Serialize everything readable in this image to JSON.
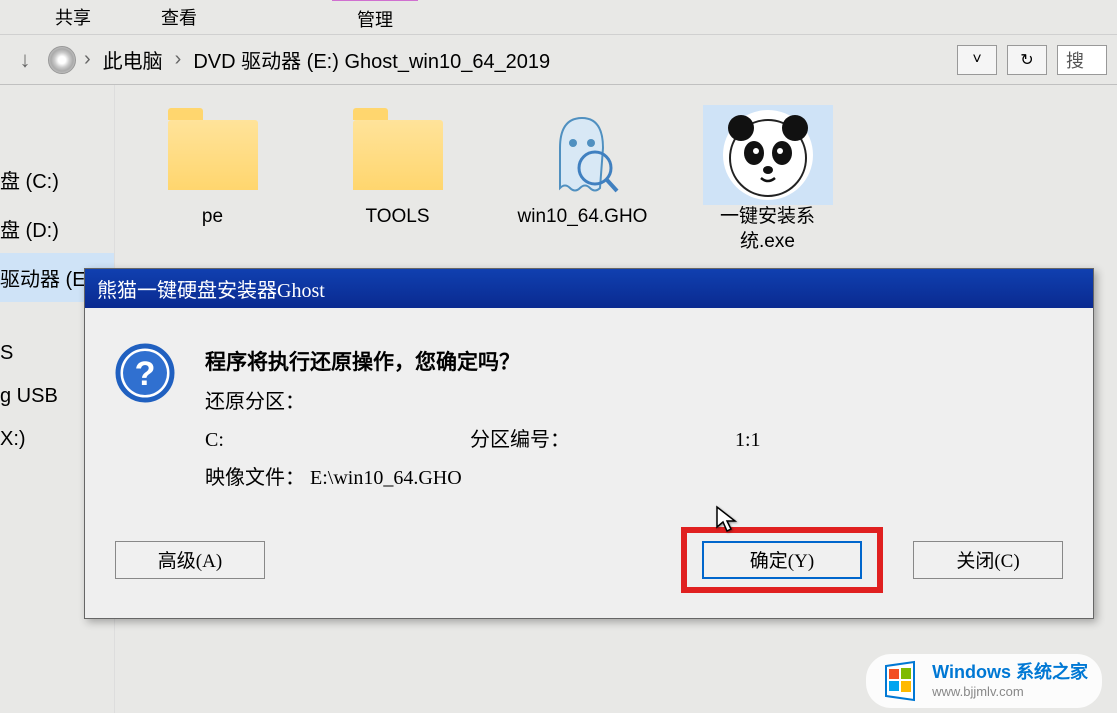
{
  "ribbon": {
    "tab_share": "共享",
    "tab_view": "查看",
    "tab_manage": "管理"
  },
  "breadcrumb": {
    "pc": "此电脑",
    "drive": "DVD 驱动器 (E:) Ghost_win10_64_2019",
    "search_placeholder": "搜"
  },
  "sidebar": {
    "items": [
      "盘 (C:)",
      "盘 (D:)",
      "驱动器 (E:) G",
      "S",
      "g USB",
      "X:)"
    ]
  },
  "files": [
    {
      "name": "pe",
      "type": "folder"
    },
    {
      "name": "TOOLS",
      "type": "folder"
    },
    {
      "name": "win10_64.GHO",
      "type": "gho"
    },
    {
      "name": "一键安装系统.exe",
      "type": "panda",
      "selected": true
    }
  ],
  "dialog": {
    "title": "熊猫一键硬盘安装器Ghost",
    "message": "程序将执行还原操作，您确定吗？",
    "restore_partition_label": "还原分区：",
    "restore_partition_value": "C:",
    "partition_num_label": "分区编号：",
    "partition_num_value": "1:1",
    "image_file_label": "映像文件：",
    "image_file_value": "E:\\win10_64.GHO",
    "btn_advanced": "高级(A)",
    "btn_ok": "确定(Y)",
    "btn_close": "关闭(C)"
  },
  "watermark": {
    "line1": "Windows 系统之家",
    "line2": "www.bjjmlv.com"
  }
}
